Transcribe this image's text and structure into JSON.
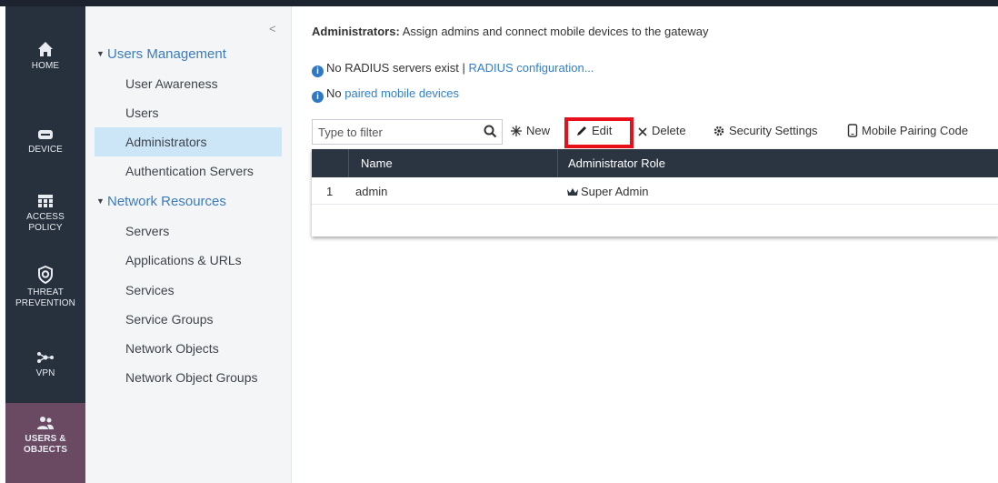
{
  "nav": {
    "items": [
      {
        "label": "HOME",
        "icon": "home-icon"
      },
      {
        "label": "DEVICE",
        "icon": "device-icon"
      },
      {
        "label": "ACCESS POLICY",
        "line1": "ACCESS",
        "line2": "POLICY",
        "icon": "access-policy-icon"
      },
      {
        "label": "THREAT PREVENTION",
        "line1": "THREAT",
        "line2": "PREVENTION",
        "icon": "threat-prevention-icon"
      },
      {
        "label": "VPN",
        "icon": "vpn-icon"
      },
      {
        "label": "USERS & OBJECTS",
        "line1": "USERS &",
        "line2": "OBJECTS",
        "icon": "users-objects-icon",
        "active": true
      }
    ]
  },
  "tree": {
    "collapse_glyph": "<",
    "groups": [
      {
        "label": "Users Management",
        "items": [
          "User Awareness",
          "Users",
          "Administrators",
          "Authentication Servers"
        ]
      },
      {
        "label": "Network Resources",
        "items": [
          "Servers",
          "Applications & URLs",
          "Services",
          "Service Groups",
          "Network Objects",
          "Network Object Groups"
        ]
      }
    ],
    "selected": "Administrators"
  },
  "header": {
    "title": "Administrators:",
    "description": " Assign admins and connect mobile devices to the gateway"
  },
  "notices": {
    "radius_text": "No RADIUS servers exist | ",
    "radius_link": "RADIUS configuration...",
    "mobile_prefix": "No ",
    "mobile_link": "paired mobile devices"
  },
  "toolbar": {
    "filter_placeholder": "Type to filter",
    "new_label": "New",
    "edit_label": "Edit",
    "delete_label": "Delete",
    "security_label": "Security Settings",
    "pairing_label": "Mobile Pairing Code"
  },
  "grid": {
    "columns": [
      "Name",
      "Administrator Role"
    ],
    "rows": [
      {
        "index": "1",
        "name": "admin",
        "role": "Super Admin"
      }
    ]
  },
  "colors": {
    "nav_bg": "#27303d",
    "nav_active": "#6a4a62",
    "accent_link": "#2f7fcf",
    "highlight": "#e8101a",
    "selection": "#cde6f7"
  }
}
